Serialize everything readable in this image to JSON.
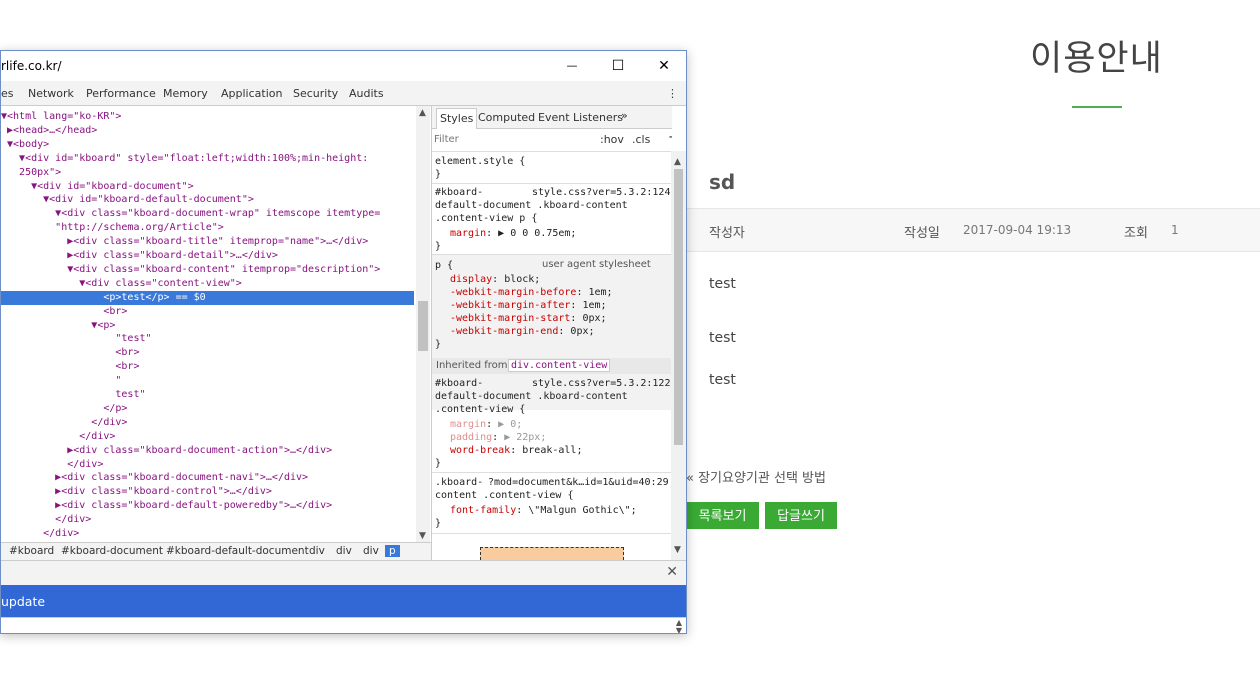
{
  "page": {
    "title": "이용안내",
    "accent_color": "#4caf50",
    "doc_title": "sd",
    "info": {
      "author_label": "작성자",
      "date_label": "작성일",
      "date_value": "2017-09-04 19:13",
      "views_label": "조회",
      "views_value": "1"
    },
    "content_lines": [
      "test",
      "test",
      "test"
    ],
    "prev_link": "« 장기요양기관 선택 방법",
    "buttons": {
      "list": "목록보기",
      "reply": "답글쓰기"
    },
    "button_color": "#3aaa35"
  },
  "devtools": {
    "window_title": "rlife.co.kr/",
    "window_buttons": {
      "minimize": "—",
      "maximize": "☐",
      "close": "✕"
    },
    "tabs": [
      "es",
      "Network",
      "Performance",
      "Memory",
      "Application",
      "Security",
      "Audits"
    ],
    "more_icon": "kebab-icon",
    "dom_lines": [
      {
        "t": "▼<html lang=\"ko-KR\">"
      },
      {
        "t": " ▶<head>…</head>"
      },
      {
        "t": " ▼<body>"
      },
      {
        "t": "   ▼<div id=\"kboard\" style=\"float:left;width:100%;min-height:"
      },
      {
        "t": "   250px\">"
      },
      {
        "t": "     ▼<div id=\"kboard-document\">"
      },
      {
        "t": "       ▼<div id=\"kboard-default-document\">"
      },
      {
        "t": "         ▼<div class=\"kboard-document-wrap\" itemscope itemtype="
      },
      {
        "t": "         \"http://schema.org/Article\">"
      },
      {
        "t": "           ▶<div class=\"kboard-title\" itemprop=\"name\">…</div>"
      },
      {
        "t": "           ▶<div class=\"kboard-detail\">…</div>"
      },
      {
        "t": "           ▼<div class=\"kboard-content\" itemprop=\"description\">"
      },
      {
        "t": "             ▼<div class=\"content-view\">"
      },
      {
        "t": "                 <p>test</p> == $0",
        "sel": true
      },
      {
        "t": "                 <br>"
      },
      {
        "t": "               ▼<p>"
      },
      {
        "t": "                   \"test\""
      },
      {
        "t": "                   <br>"
      },
      {
        "t": "                   <br>"
      },
      {
        "t": "                   \""
      },
      {
        "t": "                   test\""
      },
      {
        "t": "                 </p>"
      },
      {
        "t": "               </div>"
      },
      {
        "t": "             </div>"
      },
      {
        "t": "           ▶<div class=\"kboard-document-action\">…</div>"
      },
      {
        "t": "           </div>"
      },
      {
        "t": "         ▶<div class=\"kboard-document-navi\">…</div>"
      },
      {
        "t": "         ▶<div class=\"kboard-control\">…</div>"
      },
      {
        "t": "         ▶<div class=\"kboard-default-poweredby\">…</div>"
      },
      {
        "t": "         </div>"
      },
      {
        "t": "       </div>"
      }
    ],
    "breadcrumbs": [
      "#kboard",
      "#kboard-document",
      "#kboard-default-document",
      "div",
      "div",
      "div",
      "p"
    ],
    "styles": {
      "tabs": [
        "Styles",
        "Computed",
        "Event Listeners"
      ],
      "more": "»",
      "filter_placeholder": "Filter",
      "hov": ":hov",
      "cls": ".cls",
      "plus": "+",
      "element_style": "element.style {",
      "close_brace": "}",
      "rule1": {
        "selector": [
          "#kboard-",
          "default-document .kboard-content",
          ".content-view p {"
        ],
        "source": "style.css?ver=5.3.2:124",
        "props": [
          {
            "n": "margin",
            "v": "▶ 0 0 0.75em;"
          }
        ]
      },
      "rule2": {
        "selector": "p {",
        "source": "user agent stylesheet",
        "props": [
          {
            "n": "display",
            "v": "block;"
          },
          {
            "n": "-webkit-margin-before",
            "v": "1em;"
          },
          {
            "n": "-webkit-margin-after",
            "v": "1em;"
          },
          {
            "n": "-webkit-margin-start",
            "v": "0px;"
          },
          {
            "n": "-webkit-margin-end",
            "v": "0px;"
          }
        ]
      },
      "inherited_label": "Inherited from",
      "inherited_from": "div.content-view",
      "rule3": {
        "selector": [
          "#kboard-",
          "default-document .kboard-content",
          ".content-view {"
        ],
        "source": "style.css?ver=5.3.2:122",
        "props": [
          {
            "n": "margin",
            "v": "▶ 0;"
          },
          {
            "n": "padding",
            "v": "▶ 22px;"
          },
          {
            "n": "word-break",
            "v": "break-all;"
          }
        ]
      },
      "rule4": {
        "selector": [
          ".kboard-",
          "content .content-view {"
        ],
        "source": "?mod=document&k…id=1&uid=40:29",
        "props": [
          {
            "n": "font-family",
            "v": "\\\"Malgun Gothic\\\";"
          }
        ]
      }
    },
    "drawer_close": "✕",
    "update_text": "update"
  }
}
